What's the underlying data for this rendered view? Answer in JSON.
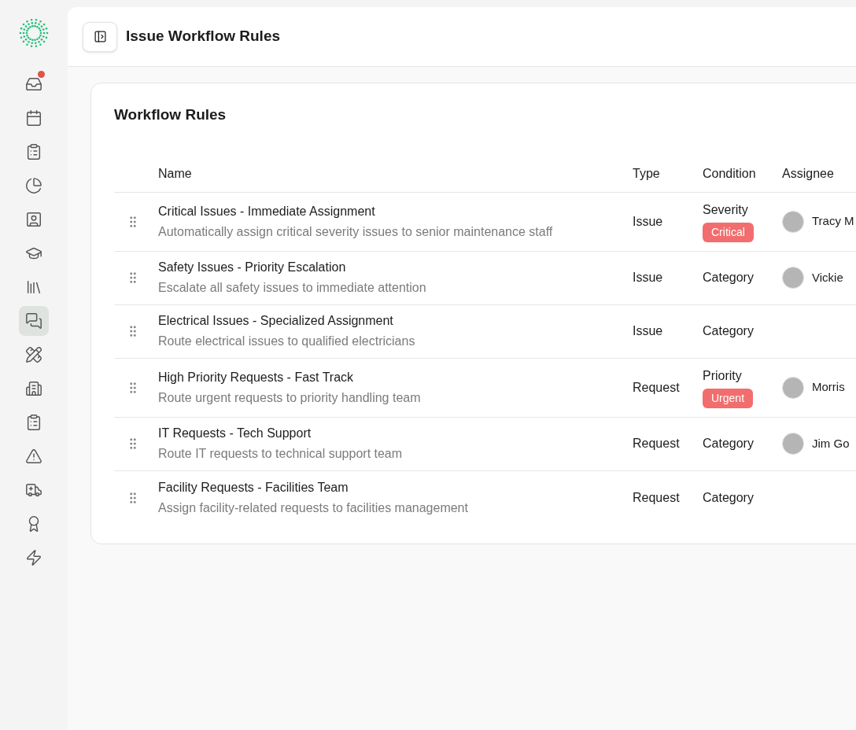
{
  "sidebar": {
    "items": [
      {
        "selected": false,
        "notification": true
      },
      {
        "selected": false,
        "notification": false
      },
      {
        "selected": false,
        "notification": false
      },
      {
        "selected": false,
        "notification": false
      },
      {
        "selected": false,
        "notification": false
      },
      {
        "selected": false,
        "notification": false
      },
      {
        "selected": false,
        "notification": false
      },
      {
        "selected": true,
        "notification": false
      },
      {
        "selected": false,
        "notification": false
      },
      {
        "selected": false,
        "notification": false
      },
      {
        "selected": false,
        "notification": false
      },
      {
        "selected": false,
        "notification": false
      },
      {
        "selected": false,
        "notification": false
      },
      {
        "selected": false,
        "notification": false
      },
      {
        "selected": false,
        "notification": false
      }
    ]
  },
  "header": {
    "title": "Issue Workflow Rules"
  },
  "card": {
    "title": "Workflow Rules",
    "table": {
      "columns": [
        "Name",
        "Type",
        "Condition",
        "Assignee"
      ],
      "rows": [
        {
          "name": "Critical Issues - Immediate Assignment",
          "description": "Automatically assign critical severity issues to senior maintenance staff",
          "type": "Issue",
          "condition": "Severity",
          "badge": "Critical",
          "assignee": "Tracy M"
        },
        {
          "name": "Safety Issues - Priority Escalation",
          "description": "Escalate all safety issues to immediate attention",
          "type": "Issue",
          "condition": "Category",
          "assignee": "Vickie"
        },
        {
          "name": "Electrical Issues - Specialized Assignment",
          "description": "Route electrical issues to qualified electricians",
          "type": "Issue",
          "condition": "Category"
        },
        {
          "name": "High Priority Requests - Fast Track",
          "description": "Route urgent requests to priority handling team",
          "type": "Request",
          "condition": "Priority",
          "badge": "Urgent",
          "assignee": "Morris"
        },
        {
          "name": "IT Requests - Tech Support",
          "description": "Route IT requests to technical support team",
          "type": "Request",
          "condition": "Category",
          "assignee": "Jim Go"
        },
        {
          "name": "Facility Requests - Facilities Team",
          "description": "Assign facility-related requests to facilities management",
          "type": "Request",
          "condition": "Category"
        }
      ]
    }
  }
}
